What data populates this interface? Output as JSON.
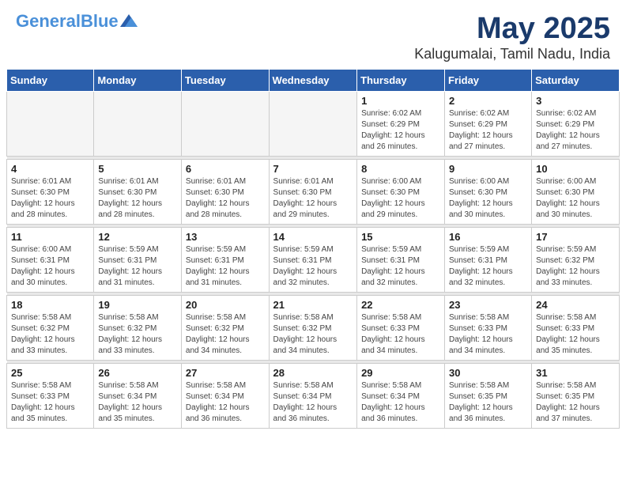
{
  "header": {
    "logo_general": "General",
    "logo_blue": "Blue",
    "month": "May 2025",
    "location": "Kalugumalai, Tamil Nadu, India"
  },
  "days_of_week": [
    "Sunday",
    "Monday",
    "Tuesday",
    "Wednesday",
    "Thursday",
    "Friday",
    "Saturday"
  ],
  "weeks": [
    [
      {
        "num": "",
        "info": ""
      },
      {
        "num": "",
        "info": ""
      },
      {
        "num": "",
        "info": ""
      },
      {
        "num": "",
        "info": ""
      },
      {
        "num": "1",
        "info": "Sunrise: 6:02 AM\nSunset: 6:29 PM\nDaylight: 12 hours\nand 26 minutes."
      },
      {
        "num": "2",
        "info": "Sunrise: 6:02 AM\nSunset: 6:29 PM\nDaylight: 12 hours\nand 27 minutes."
      },
      {
        "num": "3",
        "info": "Sunrise: 6:02 AM\nSunset: 6:29 PM\nDaylight: 12 hours\nand 27 minutes."
      }
    ],
    [
      {
        "num": "4",
        "info": "Sunrise: 6:01 AM\nSunset: 6:30 PM\nDaylight: 12 hours\nand 28 minutes."
      },
      {
        "num": "5",
        "info": "Sunrise: 6:01 AM\nSunset: 6:30 PM\nDaylight: 12 hours\nand 28 minutes."
      },
      {
        "num": "6",
        "info": "Sunrise: 6:01 AM\nSunset: 6:30 PM\nDaylight: 12 hours\nand 28 minutes."
      },
      {
        "num": "7",
        "info": "Sunrise: 6:01 AM\nSunset: 6:30 PM\nDaylight: 12 hours\nand 29 minutes."
      },
      {
        "num": "8",
        "info": "Sunrise: 6:00 AM\nSunset: 6:30 PM\nDaylight: 12 hours\nand 29 minutes."
      },
      {
        "num": "9",
        "info": "Sunrise: 6:00 AM\nSunset: 6:30 PM\nDaylight: 12 hours\nand 30 minutes."
      },
      {
        "num": "10",
        "info": "Sunrise: 6:00 AM\nSunset: 6:30 PM\nDaylight: 12 hours\nand 30 minutes."
      }
    ],
    [
      {
        "num": "11",
        "info": "Sunrise: 6:00 AM\nSunset: 6:31 PM\nDaylight: 12 hours\nand 30 minutes."
      },
      {
        "num": "12",
        "info": "Sunrise: 5:59 AM\nSunset: 6:31 PM\nDaylight: 12 hours\nand 31 minutes."
      },
      {
        "num": "13",
        "info": "Sunrise: 5:59 AM\nSunset: 6:31 PM\nDaylight: 12 hours\nand 31 minutes."
      },
      {
        "num": "14",
        "info": "Sunrise: 5:59 AM\nSunset: 6:31 PM\nDaylight: 12 hours\nand 32 minutes."
      },
      {
        "num": "15",
        "info": "Sunrise: 5:59 AM\nSunset: 6:31 PM\nDaylight: 12 hours\nand 32 minutes."
      },
      {
        "num": "16",
        "info": "Sunrise: 5:59 AM\nSunset: 6:31 PM\nDaylight: 12 hours\nand 32 minutes."
      },
      {
        "num": "17",
        "info": "Sunrise: 5:59 AM\nSunset: 6:32 PM\nDaylight: 12 hours\nand 33 minutes."
      }
    ],
    [
      {
        "num": "18",
        "info": "Sunrise: 5:58 AM\nSunset: 6:32 PM\nDaylight: 12 hours\nand 33 minutes."
      },
      {
        "num": "19",
        "info": "Sunrise: 5:58 AM\nSunset: 6:32 PM\nDaylight: 12 hours\nand 33 minutes."
      },
      {
        "num": "20",
        "info": "Sunrise: 5:58 AM\nSunset: 6:32 PM\nDaylight: 12 hours\nand 34 minutes."
      },
      {
        "num": "21",
        "info": "Sunrise: 5:58 AM\nSunset: 6:32 PM\nDaylight: 12 hours\nand 34 minutes."
      },
      {
        "num": "22",
        "info": "Sunrise: 5:58 AM\nSunset: 6:33 PM\nDaylight: 12 hours\nand 34 minutes."
      },
      {
        "num": "23",
        "info": "Sunrise: 5:58 AM\nSunset: 6:33 PM\nDaylight: 12 hours\nand 34 minutes."
      },
      {
        "num": "24",
        "info": "Sunrise: 5:58 AM\nSunset: 6:33 PM\nDaylight: 12 hours\nand 35 minutes."
      }
    ],
    [
      {
        "num": "25",
        "info": "Sunrise: 5:58 AM\nSunset: 6:33 PM\nDaylight: 12 hours\nand 35 minutes."
      },
      {
        "num": "26",
        "info": "Sunrise: 5:58 AM\nSunset: 6:34 PM\nDaylight: 12 hours\nand 35 minutes."
      },
      {
        "num": "27",
        "info": "Sunrise: 5:58 AM\nSunset: 6:34 PM\nDaylight: 12 hours\nand 36 minutes."
      },
      {
        "num": "28",
        "info": "Sunrise: 5:58 AM\nSunset: 6:34 PM\nDaylight: 12 hours\nand 36 minutes."
      },
      {
        "num": "29",
        "info": "Sunrise: 5:58 AM\nSunset: 6:34 PM\nDaylight: 12 hours\nand 36 minutes."
      },
      {
        "num": "30",
        "info": "Sunrise: 5:58 AM\nSunset: 6:35 PM\nDaylight: 12 hours\nand 36 minutes."
      },
      {
        "num": "31",
        "info": "Sunrise: 5:58 AM\nSunset: 6:35 PM\nDaylight: 12 hours\nand 37 minutes."
      }
    ]
  ]
}
